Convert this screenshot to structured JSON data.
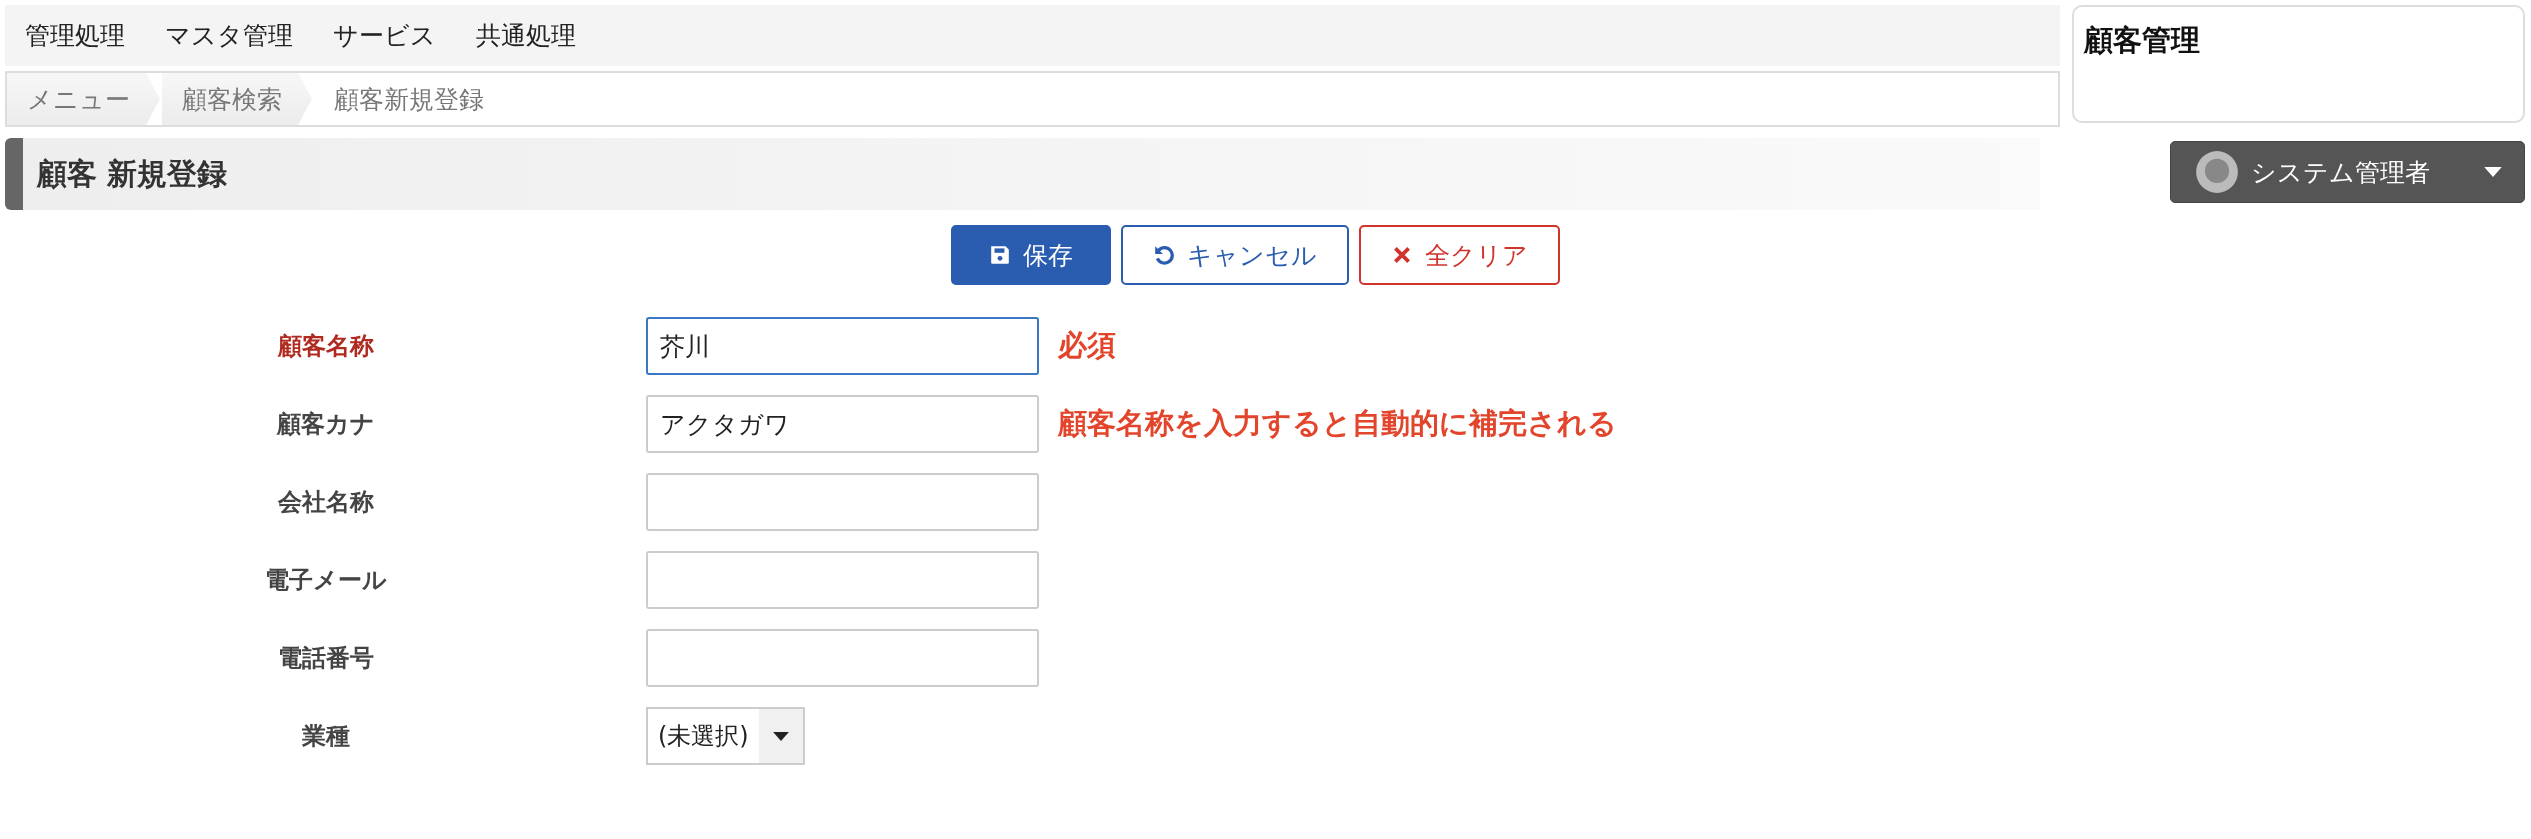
{
  "top_menu": [
    {
      "label": "管理処理"
    },
    {
      "label": "マスタ管理"
    },
    {
      "label": "サービス"
    },
    {
      "label": "共通処理"
    }
  ],
  "breadcrumb": [
    {
      "label": "メニュー",
      "current": false
    },
    {
      "label": "顧客検索",
      "current": false
    },
    {
      "label": "顧客新規登録",
      "current": true
    }
  ],
  "side_panel": {
    "title": "顧客管理"
  },
  "page_title": "顧客 新規登録",
  "user_menu": {
    "label": "システム管理者"
  },
  "buttons": [
    {
      "kind": "save",
      "label": "保存"
    },
    {
      "kind": "cancel",
      "label": "キャンセル"
    },
    {
      "kind": "clear",
      "label": "全クリア"
    }
  ],
  "fields": [
    {
      "label": "顧客名称",
      "kind": "text",
      "value": "芥川",
      "required": true,
      "focused": true,
      "note": "必須"
    },
    {
      "label": "顧客カナ",
      "kind": "text",
      "value": "アクタガワ",
      "required": false,
      "focused": false,
      "note": "顧客名称を入力すると自動的に補完される"
    },
    {
      "label": "会社名称",
      "kind": "text",
      "required": false,
      "focused": false
    },
    {
      "label": "電子メール",
      "kind": "text",
      "required": false,
      "focused": false
    },
    {
      "label": "電話番号",
      "kind": "text",
      "required": false,
      "focused": false
    },
    {
      "label": "業種",
      "kind": "select",
      "value": "(未選択)",
      "required": false,
      "focused": false
    }
  ]
}
